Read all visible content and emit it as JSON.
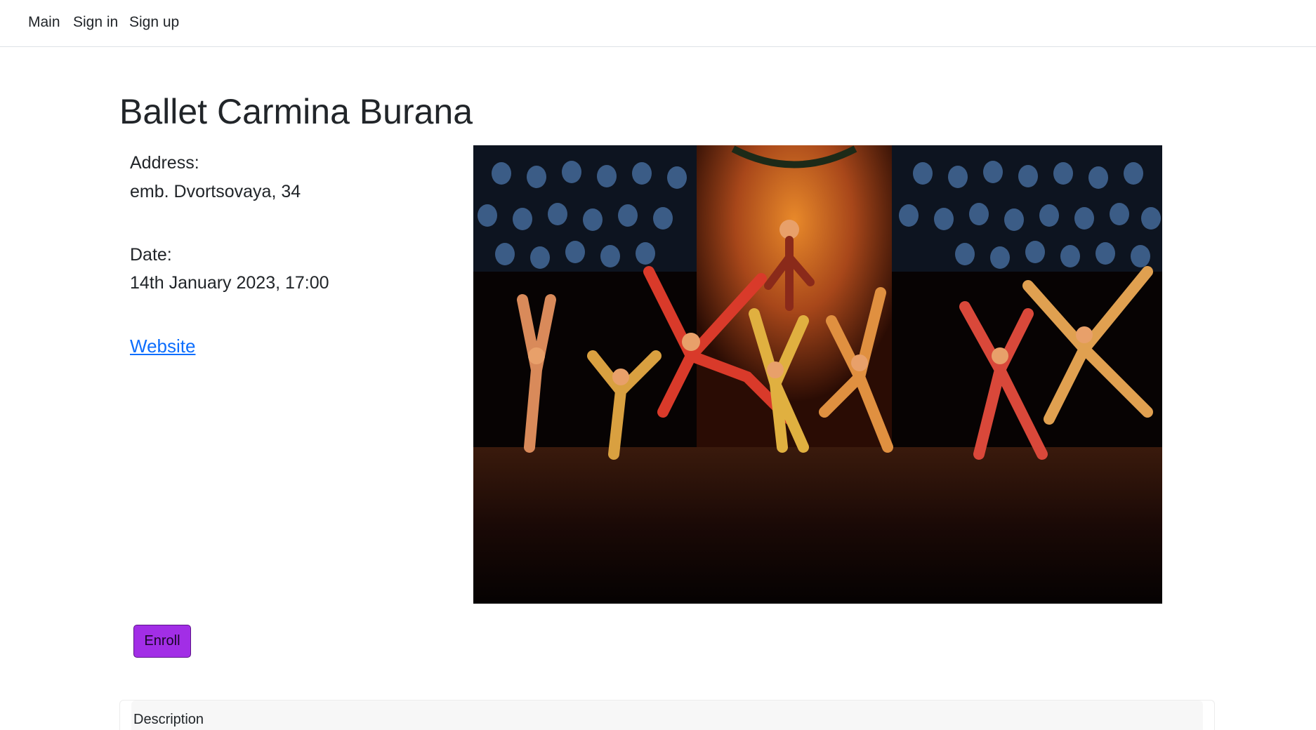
{
  "nav": {
    "items": [
      {
        "label": "Main"
      },
      {
        "label": "Sign in"
      },
      {
        "label": "Sign up"
      }
    ]
  },
  "event": {
    "title": "Ballet Carmina Burana",
    "address_label": "Address:",
    "address": "emb. Dvortsovaya, 34",
    "date_label": "Date:",
    "date": "14th January 2023, 17:00",
    "website_label": "Website",
    "enroll_label": "Enroll"
  },
  "description": {
    "header": "Description"
  },
  "colors": {
    "link": "#0d6efd",
    "enroll_button": "#a22ee6"
  }
}
